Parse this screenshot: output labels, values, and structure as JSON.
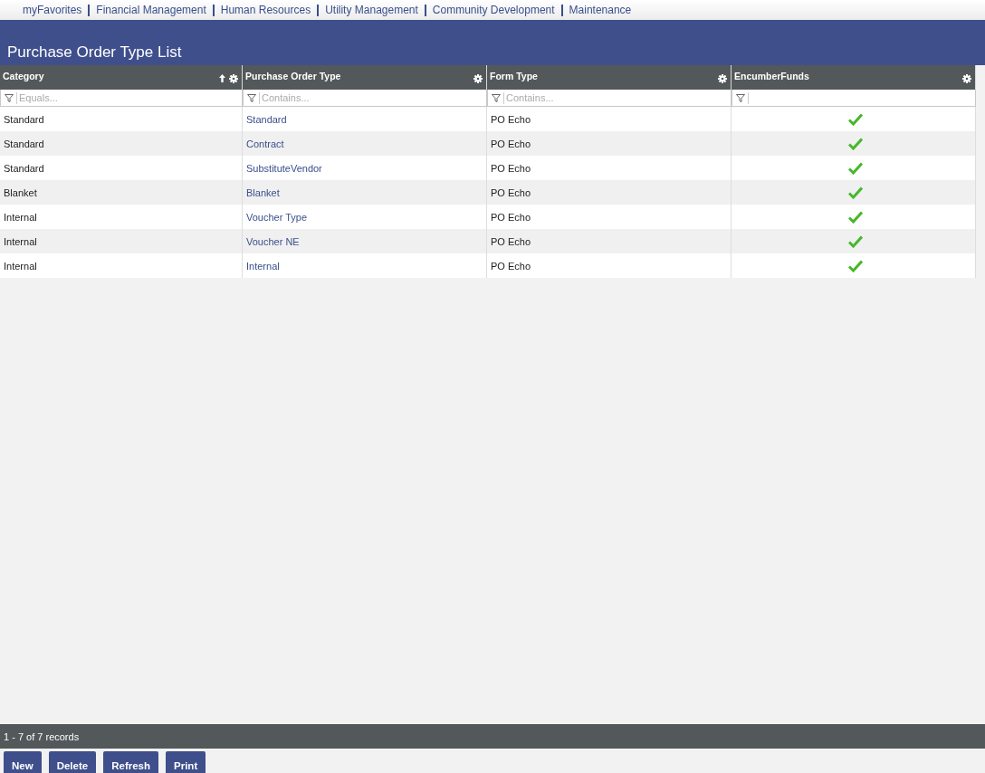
{
  "nav_links": [
    "myFavorites",
    "Financial Management",
    "Human Resources",
    "Utility Management",
    "Community Development",
    "Maintenance"
  ],
  "page_title": "Purchase Order Type List",
  "table": {
    "columns": [
      {
        "label": "Category",
        "sorted_ascending": true,
        "filter_placeholder": "Equals..."
      },
      {
        "label": "Purchase Order Type",
        "sorted_ascending": false,
        "filter_placeholder": "Contains..."
      },
      {
        "label": "Form Type",
        "sorted_ascending": false,
        "filter_placeholder": "Contains..."
      },
      {
        "label": "EncumberFunds",
        "sorted_ascending": false
      }
    ],
    "rows": [
      {
        "category": "Standard",
        "type": "Standard",
        "form": "PO Echo",
        "encumber_funds": true
      },
      {
        "category": "Standard",
        "type": "Contract",
        "form": "PO Echo",
        "encumber_funds": true
      },
      {
        "category": "Standard",
        "type": "SubstituteVendor",
        "form": "PO Echo",
        "encumber_funds": true
      },
      {
        "category": "Blanket",
        "type": "Blanket",
        "form": "PO Echo",
        "encumber_funds": true
      },
      {
        "category": "Internal",
        "type": "Voucher Type",
        "form": "PO Echo",
        "encumber_funds": true
      },
      {
        "category": "Internal",
        "type": "Voucher NE",
        "form": "PO Echo",
        "encumber_funds": true
      },
      {
        "category": "Internal",
        "type": "Internal",
        "form": "PO Echo",
        "encumber_funds": true
      }
    ]
  },
  "status_bar": "1 - 7 of 7 records",
  "buttons": [
    "New",
    "Delete",
    "Refresh",
    "Print"
  ]
}
